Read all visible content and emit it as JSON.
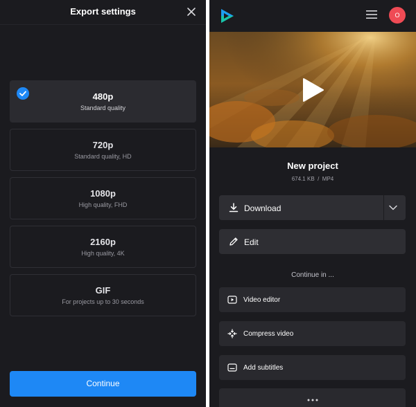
{
  "export": {
    "title": "Export settings",
    "options": [
      {
        "title": "480p",
        "subtitle": "Standard quality",
        "selected": true
      },
      {
        "title": "720p",
        "subtitle": "Standard quality, HD",
        "selected": false
      },
      {
        "title": "1080p",
        "subtitle": "High quality, FHD",
        "selected": false
      },
      {
        "title": "2160p",
        "subtitle": "High quality, 4K",
        "selected": false
      },
      {
        "title": "GIF",
        "subtitle": "For projects up to 30 seconds",
        "selected": false
      }
    ],
    "continue_label": "Continue",
    "accent_color": "#1e88f5"
  },
  "header": {
    "avatar_initial": "O",
    "avatar_color": "#ef4b55"
  },
  "project": {
    "title": "New project",
    "size": "674.1 KB",
    "separator": "/",
    "format": "MP4"
  },
  "actions": {
    "download_label": "Download",
    "edit_label": "Edit"
  },
  "continue_in": {
    "heading": "Continue in ...",
    "items": [
      {
        "label": "Video editor",
        "icon": "play-square-icon"
      },
      {
        "label": "Compress video",
        "icon": "compress-icon"
      },
      {
        "label": "Add subtitles",
        "icon": "subtitles-icon"
      }
    ]
  }
}
